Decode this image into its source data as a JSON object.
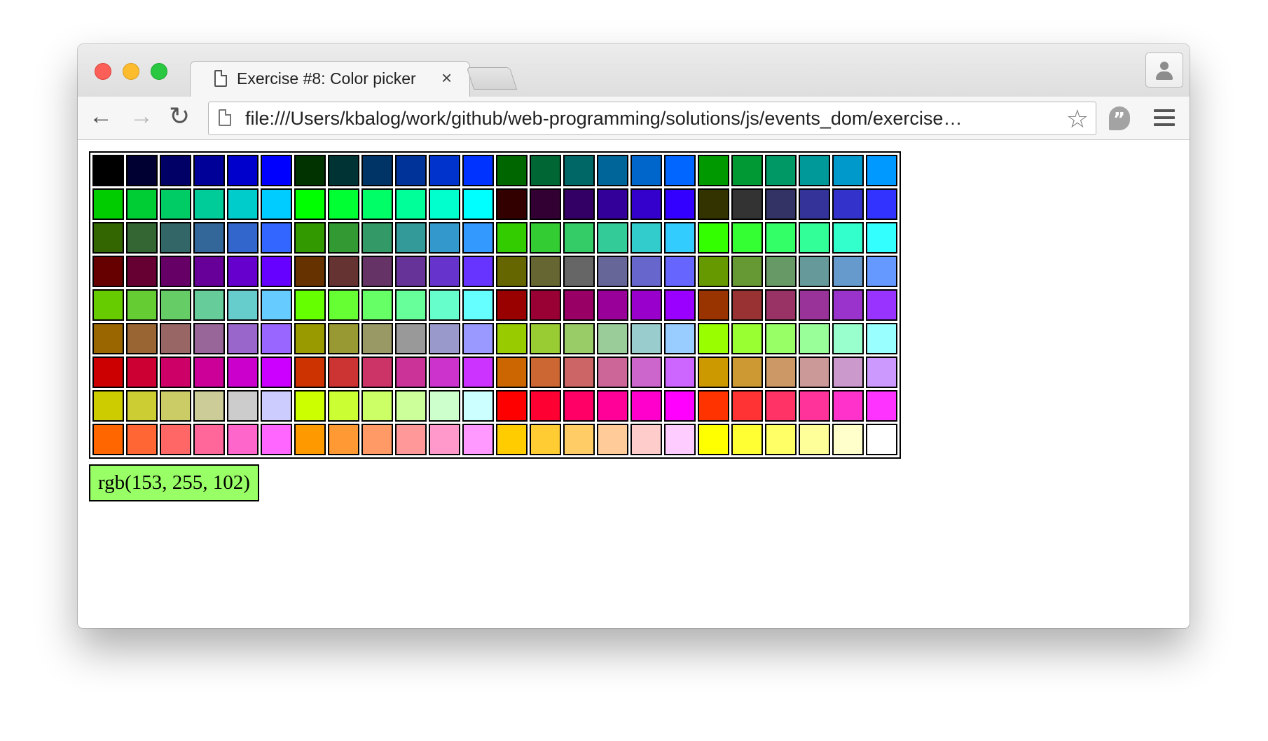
{
  "browser": {
    "tab_title": "Exercise #8: Color picker",
    "tab_close": "×",
    "back_glyph": "←",
    "forward_glyph": "→",
    "reload_glyph": "↻",
    "url": "file:///Users/kbalog/work/github/web-programming/solutions/js/events_dom/exercise…",
    "bookmark_glyph": "☆",
    "hangouts_glyph": "”"
  },
  "palette": {
    "rows": [
      [
        "#000000",
        "#000033",
        "#000066",
        "#000099",
        "#0000cc",
        "#0000ff",
        "#003300",
        "#003333",
        "#003366",
        "#003399",
        "#0033cc",
        "#0033ff",
        "#006600",
        "#006633",
        "#006666",
        "#006699",
        "#0066cc",
        "#0066ff",
        "#009900",
        "#009933",
        "#009966",
        "#009999",
        "#0099cc",
        "#0099ff"
      ],
      [
        "#00cc00",
        "#00cc33",
        "#00cc66",
        "#00cc99",
        "#00cccc",
        "#00ccff",
        "#00ff00",
        "#00ff33",
        "#00ff66",
        "#00ff99",
        "#00ffcc",
        "#00ffff",
        "#330000",
        "#330033",
        "#330066",
        "#330099",
        "#3300cc",
        "#3300ff",
        "#333300",
        "#333333",
        "#333366",
        "#333399",
        "#3333cc",
        "#3333ff"
      ],
      [
        "#336600",
        "#336633",
        "#336666",
        "#336699",
        "#3366cc",
        "#3366ff",
        "#339900",
        "#339933",
        "#339966",
        "#339999",
        "#3399cc",
        "#3399ff",
        "#33cc00",
        "#33cc33",
        "#33cc66",
        "#33cc99",
        "#33cccc",
        "#33ccff",
        "#33ff00",
        "#33ff33",
        "#33ff66",
        "#33ff99",
        "#33ffcc",
        "#33ffff"
      ],
      [
        "#660000",
        "#660033",
        "#660066",
        "#660099",
        "#6600cc",
        "#6600ff",
        "#663300",
        "#663333",
        "#663366",
        "#663399",
        "#6633cc",
        "#6633ff",
        "#666600",
        "#666633",
        "#666666",
        "#666699",
        "#6666cc",
        "#6666ff",
        "#669900",
        "#669933",
        "#669966",
        "#669999",
        "#6699cc",
        "#6699ff"
      ],
      [
        "#66cc00",
        "#66cc33",
        "#66cc66",
        "#66cc99",
        "#66cccc",
        "#66ccff",
        "#66ff00",
        "#66ff33",
        "#66ff66",
        "#66ff99",
        "#66ffcc",
        "#66ffff",
        "#990000",
        "#990033",
        "#990066",
        "#990099",
        "#9900cc",
        "#9900ff",
        "#993300",
        "#993333",
        "#993366",
        "#993399",
        "#9933cc",
        "#9933ff"
      ],
      [
        "#996600",
        "#996633",
        "#996666",
        "#996699",
        "#9966cc",
        "#9966ff",
        "#999900",
        "#999933",
        "#999966",
        "#999999",
        "#9999cc",
        "#9999ff",
        "#99cc00",
        "#99cc33",
        "#99cc66",
        "#99cc99",
        "#99cccc",
        "#99ccff",
        "#99ff00",
        "#99ff33",
        "#99ff66",
        "#99ff99",
        "#99ffcc",
        "#99ffff"
      ],
      [
        "#cc0000",
        "#cc0033",
        "#cc0066",
        "#cc0099",
        "#cc00cc",
        "#cc00ff",
        "#cc3300",
        "#cc3333",
        "#cc3366",
        "#cc3399",
        "#cc33cc",
        "#cc33ff",
        "#cc6600",
        "#cc6633",
        "#cc6666",
        "#cc6699",
        "#cc66cc",
        "#cc66ff",
        "#cc9900",
        "#cc9933",
        "#cc9966",
        "#cc9999",
        "#cc99cc",
        "#cc99ff"
      ],
      [
        "#cccc00",
        "#cccc33",
        "#cccc66",
        "#cccc99",
        "#cccccc",
        "#ccccff",
        "#ccff00",
        "#ccff33",
        "#ccff66",
        "#ccff99",
        "#ccffcc",
        "#ccffff",
        "#ff0000",
        "#ff0033",
        "#ff0066",
        "#ff0099",
        "#ff00cc",
        "#ff00ff",
        "#ff3300",
        "#ff3333",
        "#ff3366",
        "#ff3399",
        "#ff33cc",
        "#ff33ff"
      ],
      [
        "#ff6600",
        "#ff6633",
        "#ff6666",
        "#ff6699",
        "#ff66cc",
        "#ff66ff",
        "#ff9900",
        "#ff9933",
        "#ff9966",
        "#ff9999",
        "#ff99cc",
        "#ff99ff",
        "#ffcc00",
        "#ffcc33",
        "#ffcc66",
        "#ffcc99",
        "#ffcccc",
        "#ffccff",
        "#ffff00",
        "#ffff33",
        "#ffff66",
        "#ffff99",
        "#ffffcc",
        "#ffffff"
      ]
    ]
  },
  "selection": {
    "text": "rgb(153, 255, 102)",
    "color": "#99ff66"
  }
}
